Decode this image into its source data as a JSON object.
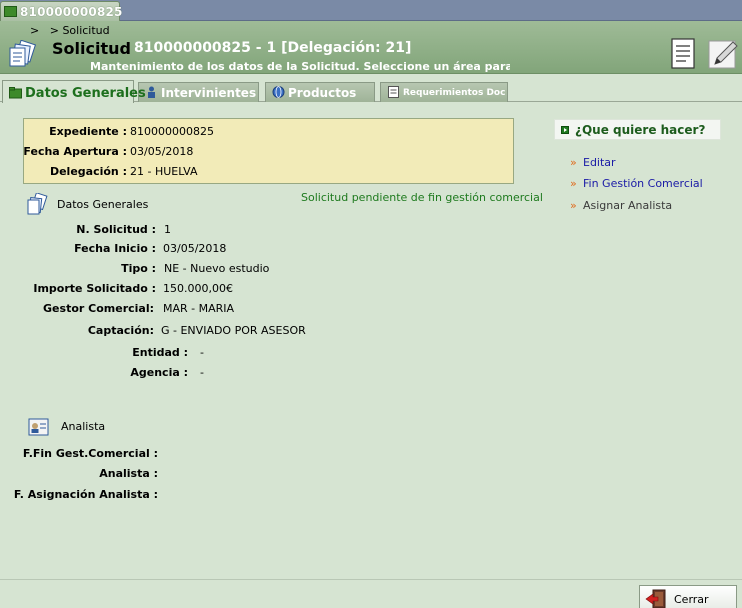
{
  "window_tab": {
    "label": "810000000825"
  },
  "breadcrumb": {
    "sep1": ">",
    "sep2": ">",
    "item": "Solicitud"
  },
  "header": {
    "title": "Solicitud",
    "subtitle": "810000000825 - 1 [Delegación: 21]",
    "description": "Mantenimiento de los datos de la Solicitud. Seleccione un área para trabaja"
  },
  "tabs": [
    {
      "label": "Datos Generales",
      "icon": "folder-icon",
      "active": true
    },
    {
      "label": "Intervinientes",
      "icon": "person-icon"
    },
    {
      "label": "Productos",
      "icon": "globe-icon"
    },
    {
      "label": "Requerimientos Doc",
      "icon": "document-icon"
    }
  ],
  "summary": [
    {
      "label": "Expediente :",
      "value": "810000000825"
    },
    {
      "label": "Fecha Apertura :",
      "value": "03/05/2018"
    },
    {
      "label": "Delegación :",
      "value": "21 - HUELVA"
    }
  ],
  "datos_generales": {
    "title": "Datos Generales",
    "status": "Solicitud pendiente de fin gestión comercial",
    "fields": [
      {
        "label": "N. Solicitud :",
        "value": "1"
      },
      {
        "label": "Fecha Inicio :",
        "value": "03/05/2018"
      },
      {
        "label": "Tipo :",
        "value": "NE - Nuevo estudio"
      },
      {
        "label": "Importe Solicitado :",
        "value": "150.000,00€"
      },
      {
        "label": "Gestor Comercial:",
        "value": "MAR - MARIA"
      },
      {
        "label": "Captación:",
        "value": "G - ENVIADO POR ASESOR"
      },
      {
        "label": "Entidad :",
        "value": "-"
      },
      {
        "label": "Agencia :",
        "value": "-"
      }
    ]
  },
  "analista": {
    "title": "Analista",
    "fields": [
      {
        "label": "F.Fin Gest.Comercial :",
        "value": ""
      },
      {
        "label": "Analista :",
        "value": ""
      },
      {
        "label": "F. Asignación Analista :",
        "value": ""
      }
    ]
  },
  "side_panel": {
    "title": "¿Que quiere hacer?",
    "actions": [
      {
        "label": "Editar",
        "chevron": "»"
      },
      {
        "label": "Fin Gestión Comercial",
        "chevron": "»"
      },
      {
        "label": "Asignar Analista",
        "chevron": "»"
      }
    ]
  },
  "footer": {
    "close_label": "Cerrar"
  },
  "colors": {
    "header_green": "#82a57a",
    "panel_bg": "#d6e4d2",
    "summary_bg": "#f2ebb8",
    "link": "#1a1aa6",
    "status_green": "#1e7a1e",
    "bullet_orange": "#e06a1c"
  }
}
